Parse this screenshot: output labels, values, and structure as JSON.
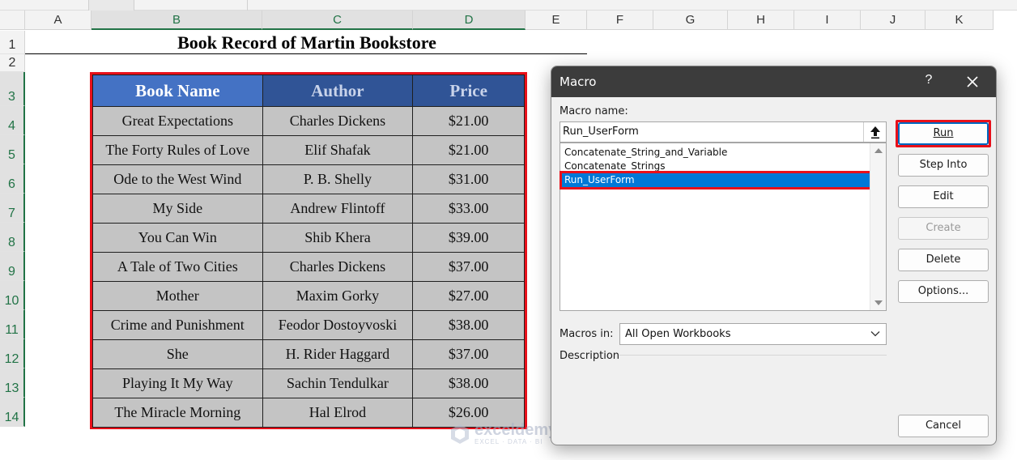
{
  "spreadsheet": {
    "columns": [
      "A",
      "B",
      "C",
      "D",
      "E",
      "F",
      "G",
      "H",
      "I",
      "J",
      "K"
    ],
    "selected_columns": [
      "B",
      "C",
      "D"
    ],
    "rows": [
      "1",
      "2",
      "3",
      "4",
      "5",
      "6",
      "7",
      "8",
      "9",
      "10",
      "11",
      "12",
      "13",
      "14"
    ],
    "selected_rows": [
      "3",
      "4",
      "5",
      "6",
      "7",
      "8",
      "9",
      "10",
      "11",
      "12",
      "13",
      "14"
    ],
    "title": "Book Record of Martin Bookstore",
    "table": {
      "headers": [
        "Book Name",
        "Author",
        "Price"
      ],
      "rows": [
        [
          "Great Expectations",
          "Charles Dickens",
          "$21.00"
        ],
        [
          "The Forty Rules of Love",
          "Elif Shafak",
          "$21.00"
        ],
        [
          "Ode to the West Wind",
          "P. B. Shelly",
          "$31.00"
        ],
        [
          "My Side",
          "Andrew Flintoff",
          "$33.00"
        ],
        [
          "You Can Win",
          "Shib Khera",
          "$39.00"
        ],
        [
          "A Tale of Two Cities",
          "Charles Dickens",
          "$37.00"
        ],
        [
          "Mother",
          "Maxim Gorky",
          "$27.00"
        ],
        [
          "Crime and Punishment",
          "Feodor Dostoyvoski",
          "$38.00"
        ],
        [
          "She",
          "H. Rider Haggard",
          "$37.00"
        ],
        [
          "Playing It My Way",
          "Sachin Tendulkar",
          "$38.00"
        ],
        [
          "The Miracle Morning",
          "Hal Elrod",
          "$26.00"
        ]
      ]
    },
    "highlight_color": "#e8101a",
    "header_color_primary": "#4472c4",
    "header_color_secondary": "#305496"
  },
  "watermark": {
    "name": "exceldemy",
    "tagline": "EXCEL · DATA · BI"
  },
  "dialog": {
    "title": "Macro",
    "help": "?",
    "macro_name_label": "Macro name:",
    "macro_name_value": "Run_UserForm",
    "macros": [
      "Concatenate_String_and_Variable",
      "Concatenate_Strings",
      "Run_UserForm"
    ],
    "selected_macro": "Run_UserForm",
    "macros_in_label": "Macros in:",
    "macros_in_value": "All Open Workbooks",
    "description_label": "Description",
    "buttons": {
      "run": "Run",
      "step_into": "Step Into",
      "edit": "Edit",
      "create": "Create",
      "delete": "Delete",
      "options": "Options...",
      "cancel": "Cancel"
    },
    "selection_color": "#0078d7"
  }
}
